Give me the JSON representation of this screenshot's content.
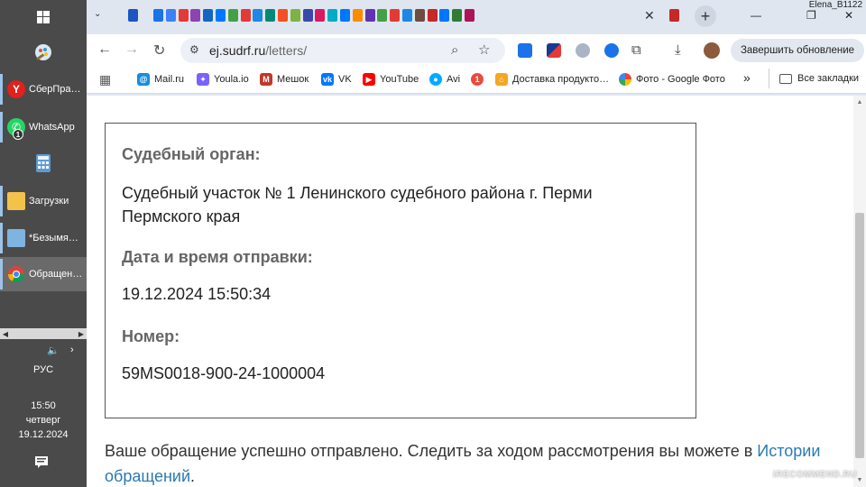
{
  "taskbar": {
    "apps": [
      {
        "label": "СберПра…",
        "icon": "yandex-icon",
        "color": "#e0211c"
      },
      {
        "label": "WhatsApp",
        "icon": "whatsapp-icon",
        "color": "#25d366",
        "badge": "1"
      },
      {
        "label": "Загрузки",
        "icon": "folder-icon",
        "color": "#f3c24a"
      },
      {
        "label": "*Безымян…",
        "icon": "notepad-icon",
        "color": "#7fb3e0"
      },
      {
        "label": "Обращен…",
        "icon": "chrome-icon",
        "color": "#4285f4"
      }
    ],
    "lang": "РУС",
    "time": "15:50",
    "weekday": "четверг",
    "date": "19.12.2024"
  },
  "browser": {
    "profile_name": "Elena_B1122",
    "url_host": "ej.sudrf.ru",
    "url_path": "/letters/",
    "update_button": "Завершить обновление",
    "bookmarks": [
      {
        "label": "Mail.ru",
        "icon": "mailru-icon",
        "color": "#168de2"
      },
      {
        "label": "Youla.io",
        "icon": "youla-icon",
        "color": "#7b61ff"
      },
      {
        "label": "Мешок",
        "icon": "meshok-icon",
        "color": "#c0392b"
      },
      {
        "label": "VK",
        "icon": "vk-icon",
        "color": "#0077ff"
      },
      {
        "label": "YouTube",
        "icon": "youtube-icon",
        "color": "#ff0000"
      },
      {
        "label": "Avi",
        "icon": "avito-icon",
        "color": "#00aaff"
      },
      {
        "label": "Доставка продукто…",
        "icon": "delivery-icon",
        "color": "#e74c3c"
      },
      {
        "label": "Фото - Google Фото",
        "icon": "google-photos-icon",
        "color": "#fbbc05"
      }
    ],
    "bookmarks_more": "»",
    "all_bookmarks": "Все закладки"
  },
  "letter": {
    "court_label": "Судебный орган:",
    "court_value": "Судебный участок № 1 Ленинского судебного района г. Перми Пермского края",
    "sent_label": "Дата и время отправки:",
    "sent_value": "19.12.2024 15:50:34",
    "number_label": "Номер:",
    "number_value": "59MS0018-900-24-1000004"
  },
  "message": {
    "text": "Ваше обращение успешно отправлено. Следить за ходом рассмотрения вы можете в",
    "link": "Истории обращений",
    "end": "."
  },
  "watermark": "iRECOMMEND.RU"
}
